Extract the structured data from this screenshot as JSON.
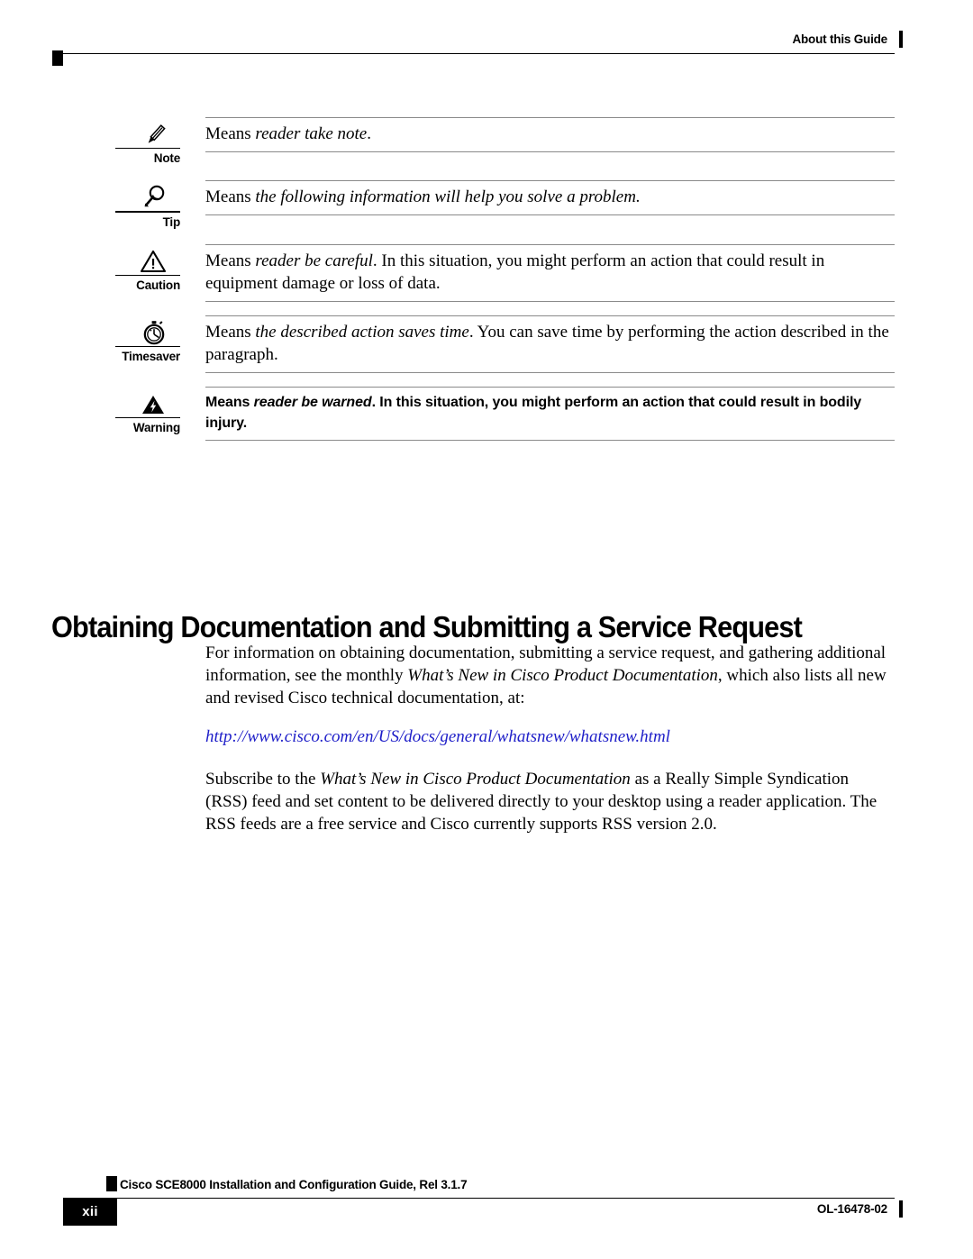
{
  "header": {
    "running_title": "About this Guide"
  },
  "notices": [
    {
      "label": "Note",
      "icon": "pencil-icon",
      "style": "serif",
      "text_html": "Means <em>reader take note</em>."
    },
    {
      "label": "Tip",
      "icon": "lightbulb-magnifier-icon",
      "style": "serif",
      "text_html": "Means <em>the following information will help you solve a problem.</em>"
    },
    {
      "label": "Caution",
      "icon": "warning-triangle-icon",
      "style": "serif",
      "text_html": "Means <em>reader be careful</em>. In this situation, you might perform an action that could result in equipment damage or loss of data."
    },
    {
      "label": "Timesaver",
      "icon": "stopwatch-icon",
      "style": "serif",
      "text_html": "Means <em>the described action saves time</em>. You can save time by performing the action described in the paragraph."
    },
    {
      "label": "Warning",
      "icon": "lightning-triangle-icon",
      "style": "bold-sans",
      "text_html": "Means <em>reader be warned</em>. In this situation, you might perform an action that could result in bodily injury."
    }
  ],
  "section": {
    "heading": "Obtaining Documentation and Submitting a Service Request",
    "paragraph_1_html": "For information on obtaining documentation, submitting a service request, and gathering additional information, see the monthly <em>What&rsquo;s New in Cisco Product Documentation</em>, which also lists all new and revised Cisco technical documentation, at:",
    "url": "http://www.cisco.com/en/US/docs/general/whatsnew/whatsnew.html",
    "paragraph_2_html": "Subscribe to the <em>What&rsquo;s New in Cisco Product Documentation</em> as a Really Simple Syndication (RSS) feed and set content to be delivered directly to your desktop using a reader application. The RSS feeds are a free service and Cisco currently supports RSS version 2.0."
  },
  "footer": {
    "guide_title": "Cisco SCE8000 Installation and Configuration Guide, Rel 3.1.7",
    "page_number": "xii",
    "doc_id": "OL-16478-02"
  },
  "colors": {
    "link": "#1e1ec8",
    "rule": "#8a8a8a",
    "ink": "#000000"
  }
}
